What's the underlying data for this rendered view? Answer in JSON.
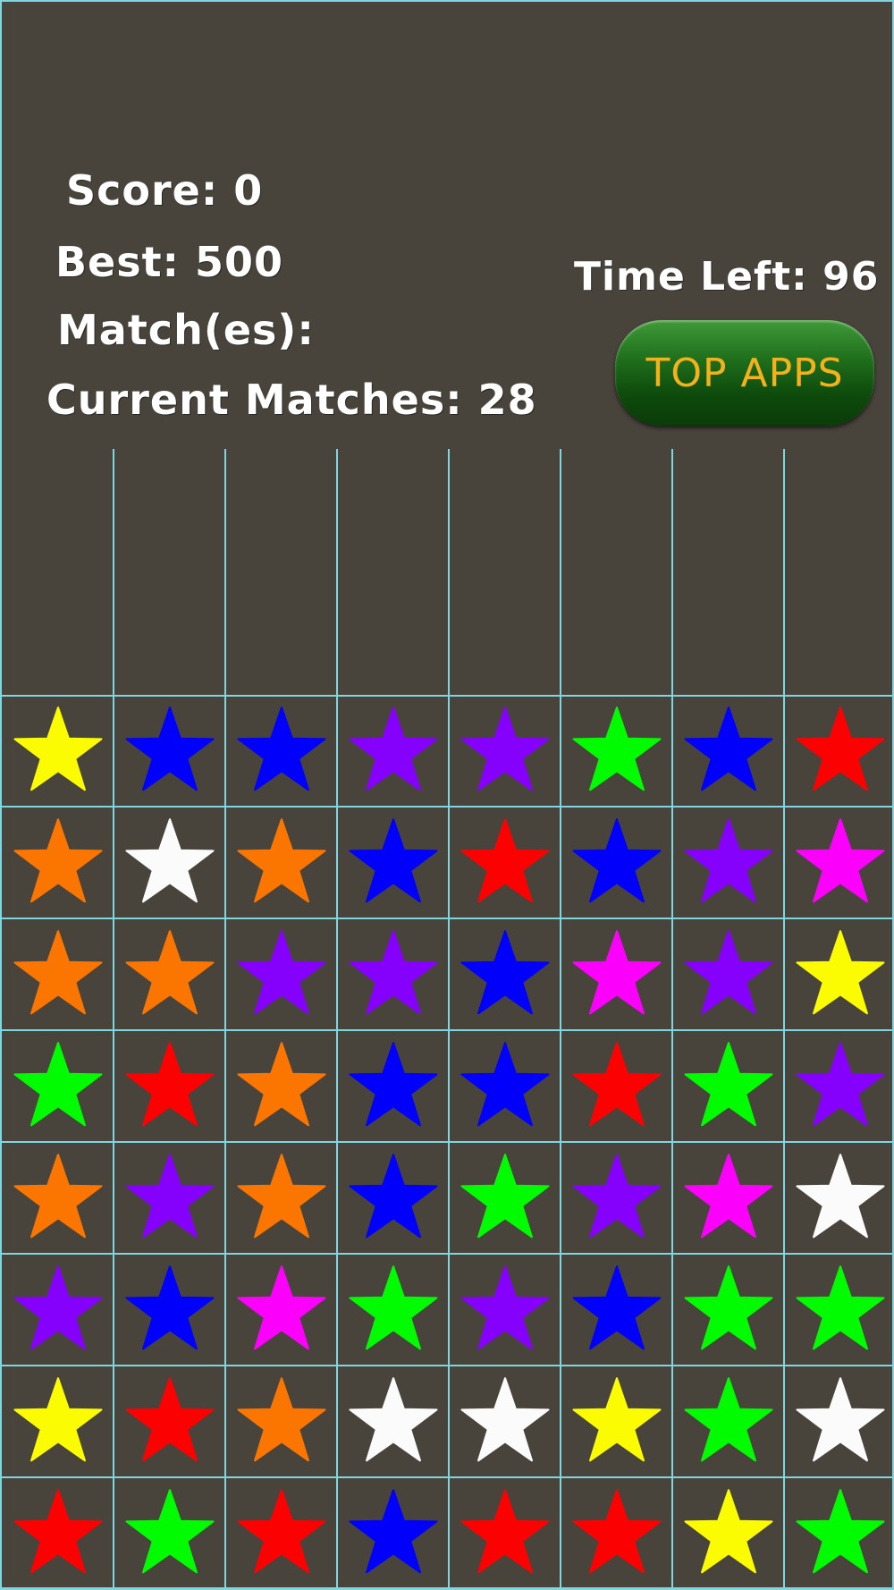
{
  "hud": {
    "score_text": "Score: 0",
    "best_text": "Best: 500",
    "matches_text": "Match(es):",
    "current_matches_text": "Current Matches: 28",
    "time_left_text": "Time Left: 96",
    "top_apps_label": "TOP APPS"
  },
  "colors": {
    "background": "#48443c",
    "grid_line": "#7fd6e0",
    "button_text": "#f3b21a",
    "yellow": "#ffff00",
    "blue": "#0000ff",
    "purple": "#8800ff",
    "green": "#00ff00",
    "red": "#ff0000",
    "orange": "#ff7700",
    "white": "#ffffff",
    "magenta": "#ff00ff"
  },
  "board": {
    "columns": 8,
    "rows": [
      [
        "yellow",
        "blue",
        "blue",
        "purple",
        "purple",
        "green",
        "blue",
        "red"
      ],
      [
        "orange",
        "white",
        "orange",
        "blue",
        "red",
        "blue",
        "purple",
        "magenta"
      ],
      [
        "orange",
        "orange",
        "purple",
        "purple",
        "blue",
        "magenta",
        "purple",
        "yellow"
      ],
      [
        "green",
        "red",
        "orange",
        "blue",
        "blue",
        "red",
        "green",
        "purple"
      ],
      [
        "orange",
        "purple",
        "orange",
        "blue",
        "green",
        "purple",
        "magenta",
        "white"
      ],
      [
        "purple",
        "blue",
        "magenta",
        "green",
        "purple",
        "blue",
        "green",
        "green"
      ],
      [
        "yellow",
        "red",
        "orange",
        "white",
        "white",
        "yellow",
        "green",
        "white"
      ],
      [
        "red",
        "green",
        "red",
        "blue",
        "red",
        "red",
        "yellow",
        "green"
      ]
    ]
  }
}
